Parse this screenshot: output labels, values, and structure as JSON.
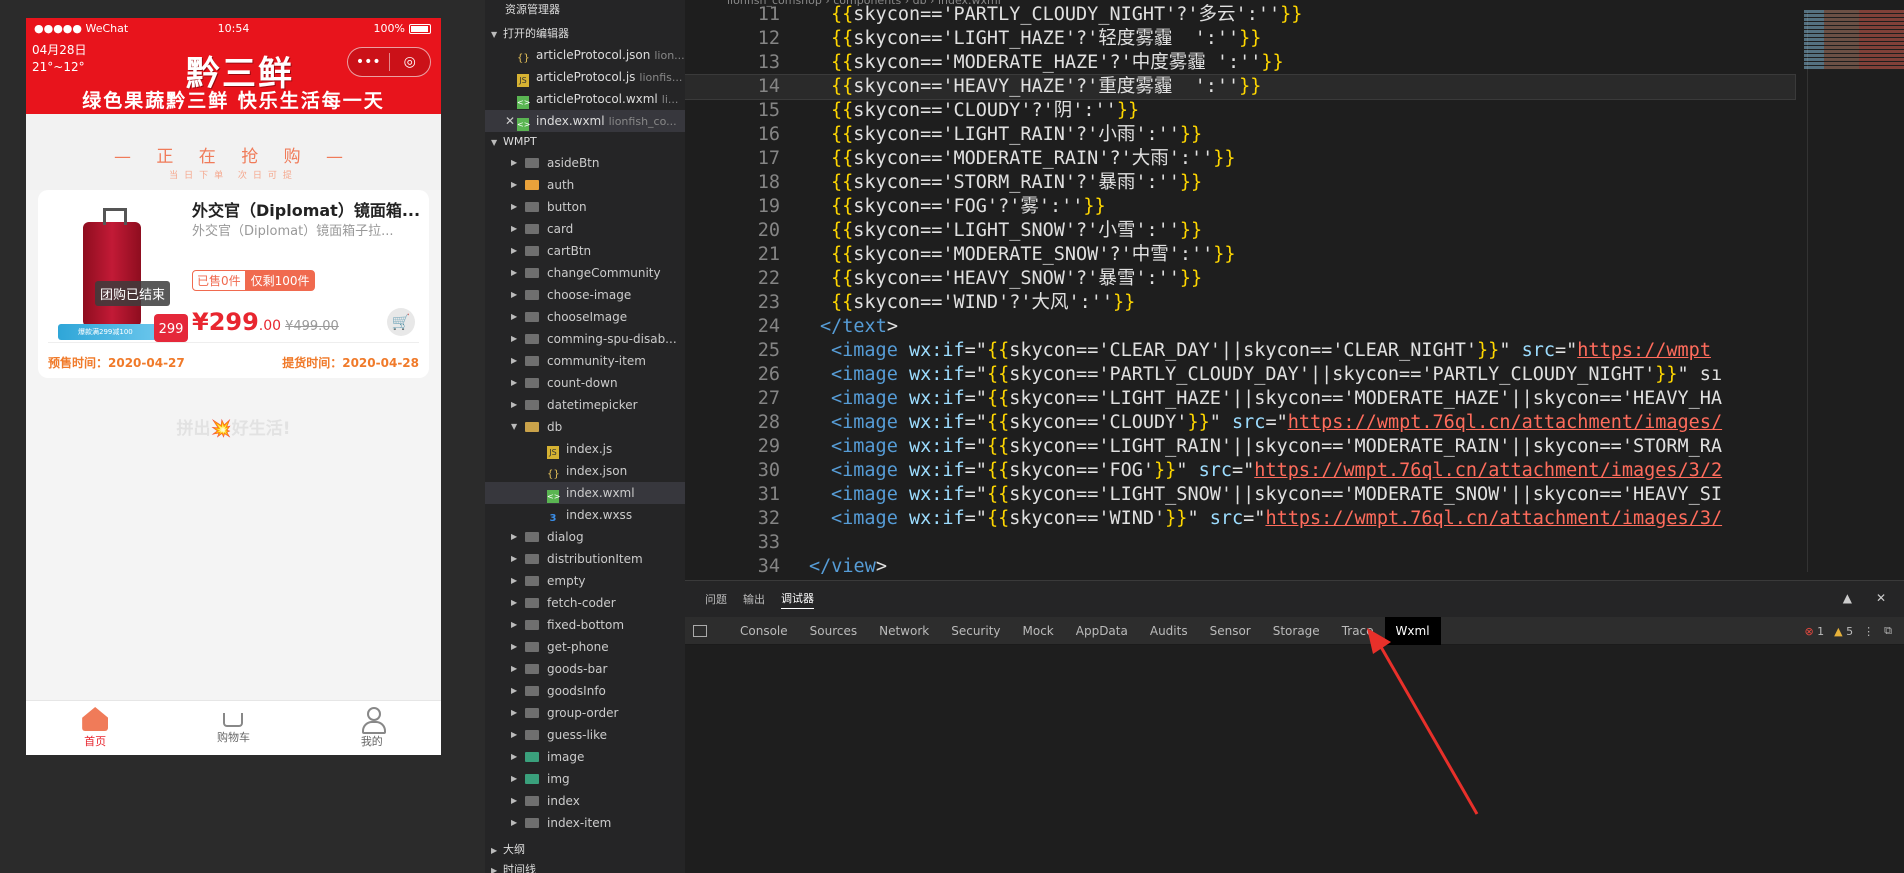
{
  "phone": {
    "status": {
      "signal": "●●●●● WeChat",
      "time": "10:54",
      "battery": "100%"
    },
    "date": "04月28日",
    "temp": "21°~12°",
    "logo": "黔三鲜",
    "capsule_more": "•••",
    "capsule_close": "◎",
    "slogan": "绿色果蔬黔三鲜 快乐生活每一天",
    "flash_title": "— 正 在 抢 购 —",
    "flash_sub": "当日下单 次日可提",
    "product": {
      "title": "外交官（Diplomat）镜面箱...",
      "desc": "外交官（Diplomat）镜面箱子拉...",
      "ended_tag": "团购已结束",
      "promo_strip": "爆款满299减100",
      "price_badge": "299",
      "sold": "已售0件",
      "remaining": "仅剩100件",
      "price_main": "¥299",
      "price_dec": ".00",
      "price_orig": "¥499.00",
      "presale": "预售时间：2020-04-27",
      "pickup": "提货时间：2020-04-28"
    },
    "footer_slogan": "拼出💥好生活!",
    "tabs": [
      {
        "label": "首页",
        "icon": "home-icon"
      },
      {
        "label": "购物车",
        "icon": "cart-icon"
      },
      {
        "label": "我的",
        "icon": "profile-icon"
      }
    ]
  },
  "explorer": {
    "title": "资源管理器",
    "open_editors_label": "打开的编辑器",
    "open_files": [
      {
        "name": "articleProtocol.json",
        "path": "lion..."
      },
      {
        "name": "articleProtocol.js",
        "path": "lionfis..."
      },
      {
        "name": "articleProtocol.wxml",
        "path": "li..."
      },
      {
        "name": "index.wxml",
        "path": "lionfish_co..."
      }
    ],
    "project_label": "WMPT",
    "folders_before": [
      "asideBtn",
      "auth",
      "button",
      "card",
      "cartBtn",
      "changeCommunity",
      "choose-image",
      "chooseImage",
      "comming-spu-disab...",
      "community-item",
      "count-down",
      "datetimepicker"
    ],
    "open_folder": "db",
    "db_files": [
      "index.js",
      "index.json",
      "index.wxml",
      "index.wxss"
    ],
    "folders_after": [
      "dialog",
      "distributionItem",
      "empty",
      "fetch-coder",
      "fixed-bottom",
      "get-phone",
      "goods-bar",
      "goodsInfo",
      "group-order",
      "guess-like",
      "image",
      "img",
      "index",
      "index-item"
    ],
    "outline_label": "大纲",
    "timeline_label": "时间线"
  },
  "editor": {
    "breadcrumb": "lionfish_comshop › components › db › index.wxml",
    "lines": [
      {
        "n": "11",
        "t": "{{skycon=='PARTLY_CLOUDY_NIGHT'?'多云':''}}"
      },
      {
        "n": "12",
        "t": "{{skycon=='LIGHT_HAZE'?'轻度雾霾  ':''}}"
      },
      {
        "n": "13",
        "t": "{{skycon=='MODERATE_HAZE'?'中度雾霾 ':''}}"
      },
      {
        "n": "14",
        "t": "{{skycon=='HEAVY_HAZE'?'重度雾霾  ':''}}"
      },
      {
        "n": "15",
        "t": "{{skycon=='CLOUDY'?'阴':''}}"
      },
      {
        "n": "16",
        "t": "{{skycon=='LIGHT_RAIN'?'小雨':''}}"
      },
      {
        "n": "17",
        "t": "{{skycon=='MODERATE_RAIN'?'大雨':''}}"
      },
      {
        "n": "18",
        "t": "{{skycon=='STORM_RAIN'?'暴雨':''}}"
      },
      {
        "n": "19",
        "t": "{{skycon=='FOG'?'雾':''}}"
      },
      {
        "n": "20",
        "t": "{{skycon=='LIGHT_SNOW'?'小雪':''}}"
      },
      {
        "n": "21",
        "t": "{{skycon=='MODERATE_SNOW'?'中雪':''}}"
      },
      {
        "n": "22",
        "t": "{{skycon=='HEAVY_SNOW'?'暴雪':''}}"
      },
      {
        "n": "23",
        "t": "{{skycon=='WIND'?'大风':''}}"
      },
      {
        "n": "24",
        "t": "</text>"
      },
      {
        "n": "25",
        "t": "<image wx:if=\"{{skycon=='CLEAR_DAY'||skycon=='CLEAR_NIGHT'}}\" src=\"https://wmpt"
      },
      {
        "n": "26",
        "t": "<image wx:if=\"{{skycon=='PARTLY_CLOUDY_DAY'||skycon=='PARTLY_CLOUDY_NIGHT'}}\" sı"
      },
      {
        "n": "27",
        "t": "<image wx:if=\"{{skycon=='LIGHT_HAZE'||skycon=='MODERATE_HAZE'||skycon=='HEAVY_HA"
      },
      {
        "n": "28",
        "t": "<image wx:if=\"{{skycon=='CLOUDY'}}\" src=\"https://wmpt.76ql.cn/attachment/images/"
      },
      {
        "n": "29",
        "t": "<image wx:if=\"{{skycon=='LIGHT_RAIN'||skycon=='MODERATE_RAIN'||skycon=='STORM_RA"
      },
      {
        "n": "30",
        "t": "<image wx:if=\"{{skycon=='FOG'}}\" src=\"https://wmpt.76ql.cn/attachment/images/3/2"
      },
      {
        "n": "31",
        "t": "<image wx:if=\"{{skycon=='LIGHT_SNOW'||skycon=='MODERATE_SNOW'||skycon=='HEAVY_SI"
      },
      {
        "n": "32",
        "t": "<image wx:if=\"{{skycon=='WIND'}}\" src=\"https://wmpt.76ql.cn/attachment/images/3/"
      },
      {
        "n": "33",
        "t": ""
      },
      {
        "n": "34",
        "t": "</view>"
      }
    ]
  },
  "debug": {
    "top_tabs": [
      "问题",
      "输出",
      "调试器"
    ],
    "devtools_tabs": [
      "Console",
      "Sources",
      "Network",
      "Security",
      "Mock",
      "AppData",
      "Audits",
      "Sensor",
      "Storage",
      "Trace",
      "Wxml"
    ],
    "errors": "1",
    "warnings": "5",
    "arrow_color": "#e8302a"
  }
}
